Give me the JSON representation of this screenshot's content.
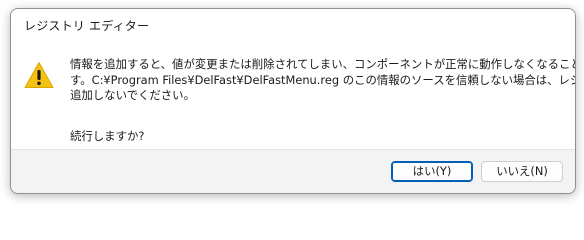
{
  "dialog": {
    "title": "レジストリ エディター",
    "icon": "warning-icon",
    "message_lines": [
      "情報を追加すると、値が変更または削除されてしまい、コンポーネントが正常に動作しなくなることがありま",
      "す。C:¥Program Files¥DelFast¥DelFastMenu.reg のこの情報のソースを信頼しない場合は、レジストリに",
      "追加しないでください。"
    ],
    "question": "続行しますか?",
    "buttons": {
      "yes_label": "はい(Y)",
      "no_label": "いいえ(N)"
    },
    "colors": {
      "accent": "#005fb8",
      "warning": "#f5c211",
      "footer": "#f3f3f3"
    }
  }
}
